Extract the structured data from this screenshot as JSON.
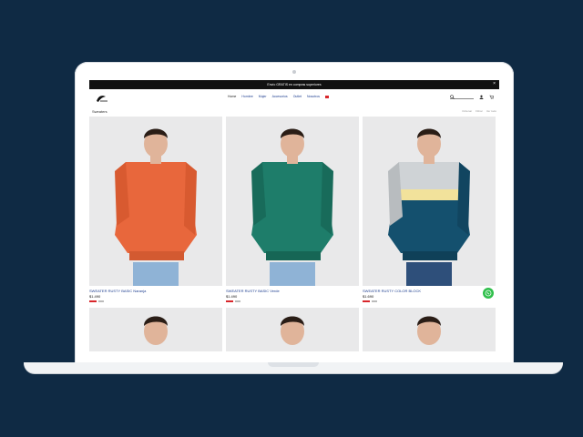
{
  "colors": {
    "background": "#0f2a44",
    "announce_bar": "#111111",
    "link_blue": "#1c3d8f",
    "sale_red": "#d8262b",
    "whatsapp_green": "#2fbf4b",
    "sweater_orange": "#e8673c",
    "sweater_green": "#1e7d6a",
    "sweater_navy": "#14506e",
    "sweater_gray": "#cfd3d6",
    "stripe_yellow": "#f2e29b"
  },
  "announcement": {
    "text": "Envío GRATIS en compras superiores"
  },
  "header": {
    "nav": [
      "Home",
      "Hombre",
      "Mujer",
      "Accesorios",
      "Outlet",
      "Nosotros"
    ]
  },
  "subbar": {
    "breadcrumb": "Sweaters",
    "sort_options": [
      "Ordenar",
      "Filtrar",
      "Ver todo"
    ]
  },
  "products": [
    {
      "name": "SWEATER RUSTY BASIC Naranja",
      "price": "$1.490",
      "color": "orange"
    },
    {
      "name": "SWEATER RUSTY BASIC Verde",
      "price": "$1.490",
      "color": "green"
    },
    {
      "name": "SWEATER RUSTY COLOR BLOCK",
      "price": "$1.690",
      "color": "block"
    },
    {
      "name": "",
      "price": "",
      "color": "gray"
    },
    {
      "name": "",
      "price": "",
      "color": "gray"
    },
    {
      "name": "",
      "price": "",
      "color": "gray"
    }
  ],
  "icons": [
    "logo-icon",
    "search-icon",
    "user-icon",
    "cart-icon",
    "close-icon",
    "whatsapp-icon"
  ]
}
